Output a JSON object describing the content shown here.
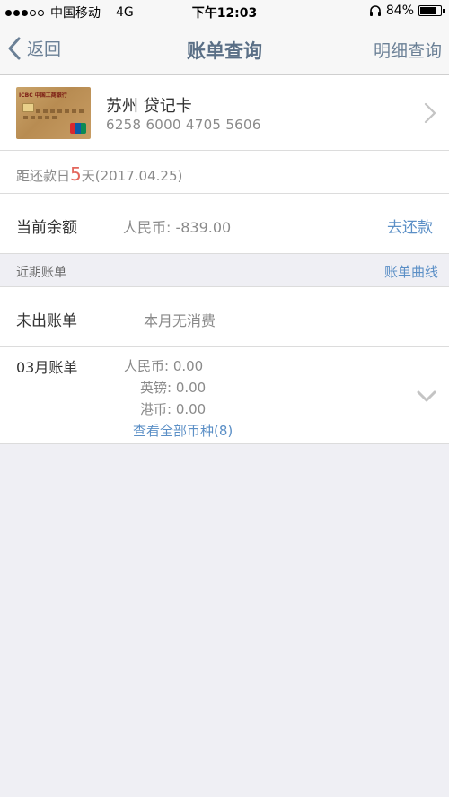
{
  "status_bar": {
    "carrier": "中国移动",
    "network": "4G",
    "time": "下午12:03",
    "battery": "84%",
    "battery_level": 0.84
  },
  "nav": {
    "back_label": "返回",
    "title": "账单查询",
    "right_label": "明细查询"
  },
  "card": {
    "bank_logo_text": "ICBC 中国工商银行",
    "name": "苏州 贷记卡",
    "number": "6258 6000 4705 5606"
  },
  "due": {
    "prefix": "距还款日",
    "days": "5",
    "suffix": "天(2017.04.25)"
  },
  "balance": {
    "label": "当前余额",
    "value": "人民币: -839.00",
    "action": "去还款"
  },
  "recent": {
    "title": "近期账单",
    "link": "账单曲线"
  },
  "unbilled": {
    "label": "未出账单",
    "value": "本月无消费"
  },
  "march": {
    "label": "03月账单",
    "amounts": [
      "人民币: 0.00",
      "英镑: 0.00",
      "港币: 0.00"
    ],
    "view_all": "查看全部币种(8)"
  },
  "colors": {
    "accent": "#5b8fc6",
    "nav_text": "#6b8096",
    "highlight": "#e3665c",
    "background": "#efeff4"
  },
  "icons": [
    "back-chevron-icon",
    "headphones-icon",
    "battery-icon",
    "chevron-right-icon",
    "chevron-down-icon"
  ]
}
